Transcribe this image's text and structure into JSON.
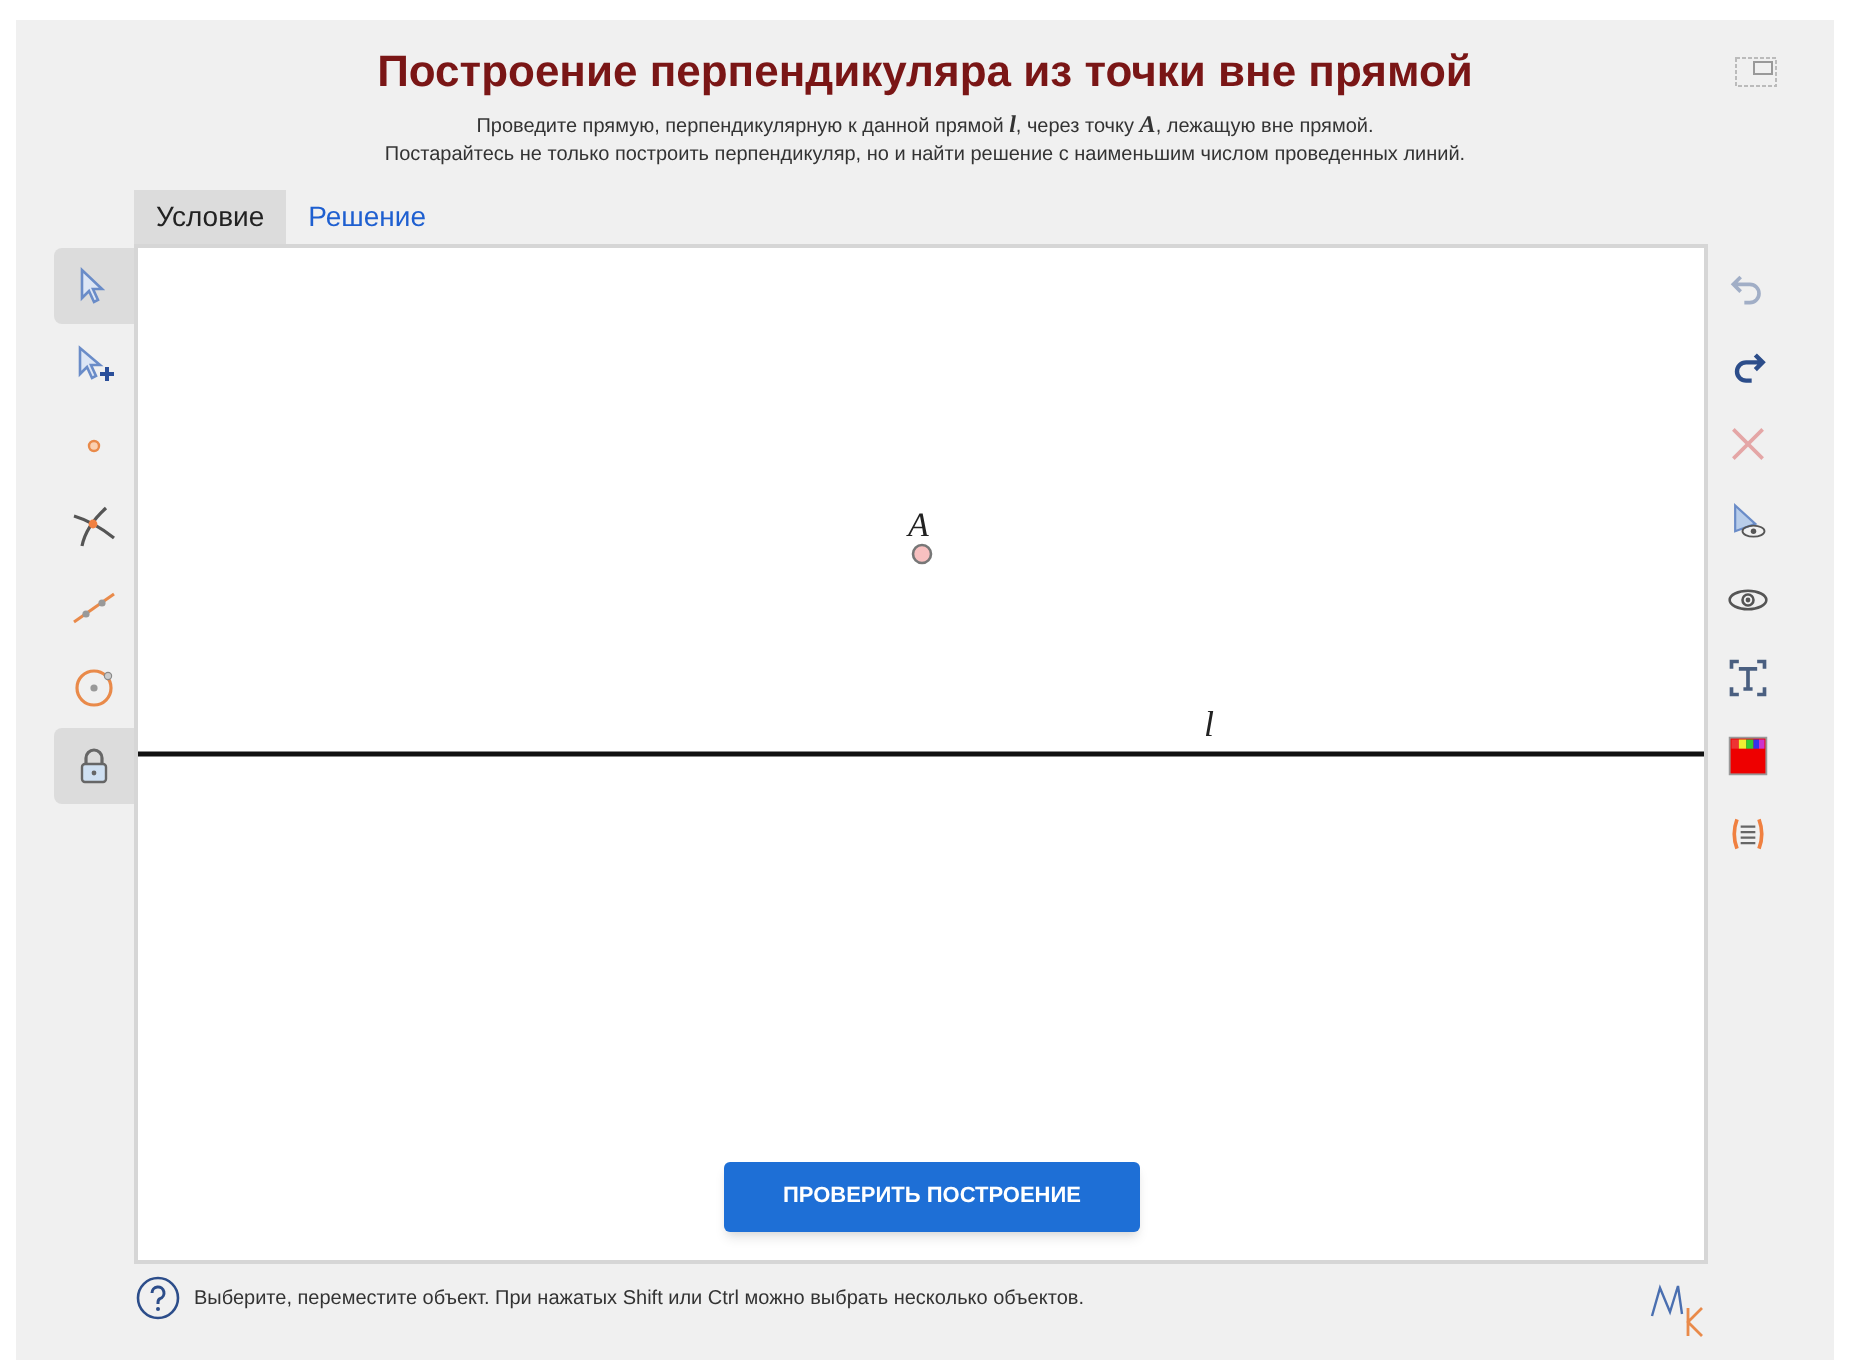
{
  "title": "Построение перпендикуляра из точки вне прямой",
  "instructions": [
    "Проведите прямую, перпендикулярную к данной прямой *l*, через точку *A*, лежащую вне прямой.",
    "Постарайтесь не только построить перпендикуляр, но и найти решение с наименьшим числом проведенных линий."
  ],
  "tabs": [
    {
      "label": "Условие",
      "selected": true
    },
    {
      "label": "Решение",
      "selected": false
    }
  ],
  "left_tools": [
    {
      "kind": "select",
      "selected": true
    },
    {
      "kind": "multi-select",
      "selected": false
    },
    {
      "kind": "point",
      "selected": false
    },
    {
      "kind": "intersection",
      "selected": false
    },
    {
      "kind": "line",
      "selected": false
    },
    {
      "kind": "circle",
      "selected": false
    },
    {
      "kind": "lock",
      "selected": true
    }
  ],
  "right_tools": [
    {
      "kind": "undo",
      "disabled": true
    },
    {
      "kind": "redo",
      "disabled": false
    },
    {
      "kind": "delete",
      "disabled": true
    },
    {
      "kind": "select-hide",
      "disabled": false
    },
    {
      "kind": "show",
      "disabled": false
    },
    {
      "kind": "text",
      "disabled": false
    },
    {
      "kind": "color",
      "disabled": false
    },
    {
      "kind": "list",
      "disabled": false
    }
  ],
  "canvas": {
    "point": {
      "label": "A"
    },
    "line": {
      "label": "l"
    }
  },
  "check_button": "ПРОВЕРИТЬ ПОСТРОЕНИЕ",
  "status_text": "Выберите, переместите объект. При нажатых Shift или Ctrl можно выбрать несколько объектов."
}
